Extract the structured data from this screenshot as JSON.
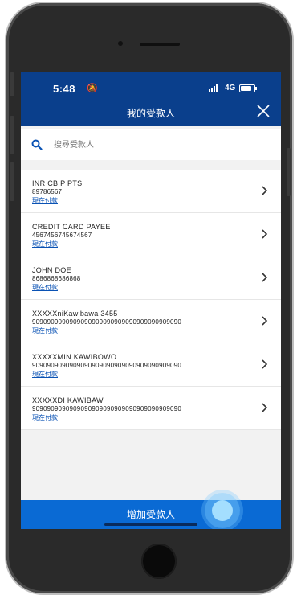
{
  "status_bar": {
    "time": "5:48",
    "network": "4G"
  },
  "header": {
    "title": "我的受款人"
  },
  "search": {
    "placeholder": "搜尋受款人"
  },
  "payees": [
    {
      "name": "INR CBIP PTS",
      "account": "89786567",
      "pay_label": "現在付款"
    },
    {
      "name": "CREDIT CARD PAYEE",
      "account": "4567456745674567",
      "pay_label": "現在付款"
    },
    {
      "name": "JOHN DOE",
      "account": "8686868686868",
      "pay_label": "現在付款"
    },
    {
      "name": "XXXXXniKawibawa 3455",
      "account": "9090909090909090909090909090909090909090",
      "pay_label": "現在付款"
    },
    {
      "name": "XXXXXMIN KAWIBOWO",
      "account": "9090909090909090909090909090909090909090",
      "pay_label": "現在付款"
    },
    {
      "name": "XXXXXDI KAWIBAW",
      "account": "9090909090909090909090909090909090909090",
      "pay_label": "現在付款"
    }
  ],
  "footer": {
    "add_payee_label": "增加受款人"
  },
  "colors": {
    "header_bg": "#0a3f8c",
    "button_bg": "#0a6ad4",
    "link": "#0a52b4"
  }
}
